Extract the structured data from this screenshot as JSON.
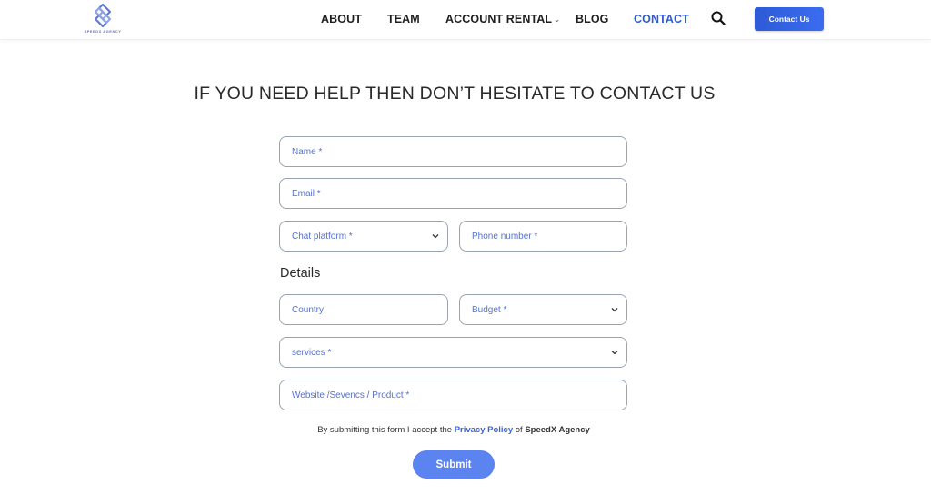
{
  "header": {
    "logo_text": "SPEEDX AGENCY",
    "nav": [
      {
        "label": "ABOUT",
        "active": false
      },
      {
        "label": "TEAM",
        "active": false
      },
      {
        "label": "ACCOUNT RENTAL",
        "active": false,
        "has_dropdown": true
      },
      {
        "label": "BLOG",
        "active": false
      },
      {
        "label": "CONTACT",
        "active": true
      }
    ],
    "search_icon": "search-icon",
    "cta_label": "Contact Us"
  },
  "main": {
    "title": "IF YOU NEED HELP THEN DON’T HESITATE TO CONTACT US",
    "fields": {
      "name": {
        "placeholder": "Name *",
        "value": ""
      },
      "email": {
        "placeholder": "Email *",
        "value": ""
      },
      "chat_platform": {
        "placeholder": "Chat platform *",
        "value": ""
      },
      "phone": {
        "placeholder": "Phone number *",
        "value": ""
      },
      "country": {
        "placeholder": "Country",
        "value": ""
      },
      "budget": {
        "placeholder": "Budget *",
        "value": ""
      },
      "services": {
        "placeholder": "services *",
        "value": ""
      },
      "website": {
        "placeholder": "Website /Sevencs / Product *",
        "value": ""
      }
    },
    "details_label": "Details",
    "consent": {
      "prefix": "By submitting this form I accept the",
      "link": "Privacy Policy",
      "middle": "of",
      "brand": "SpeedX Agency"
    },
    "submit_label": "Submit"
  },
  "colors": {
    "accent": "#2f5bd6",
    "submit": "#5b84f0",
    "placeholder": "#5572c9",
    "border": "#9aa3b3"
  }
}
